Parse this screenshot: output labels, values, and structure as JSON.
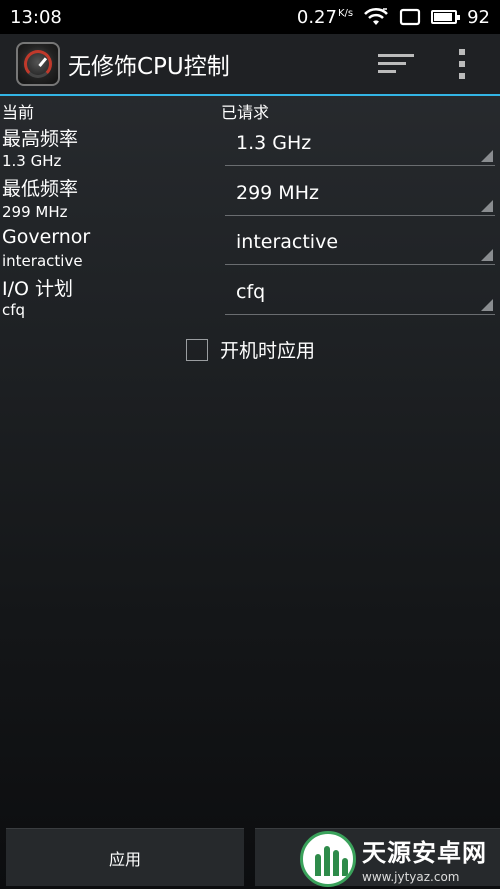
{
  "status_bar": {
    "time": "13:08",
    "net_speed": "0.27",
    "net_unit": "K/s",
    "battery": "92",
    "battery_level": 0.92
  },
  "action_bar": {
    "title": "无修饰CPU控制",
    "sort_icon": "sort-icon",
    "overflow_icon": "overflow-menu-icon"
  },
  "columns": {
    "current": "当前",
    "requested": "已请求"
  },
  "rows": [
    {
      "label": "最高频率",
      "current": "1.3 GHz",
      "requested": "1.3 GHz"
    },
    {
      "label": "最低频率",
      "current": "299 MHz",
      "requested": "299 MHz"
    },
    {
      "label": "Governor",
      "current": "interactive",
      "requested": "interactive"
    },
    {
      "label": "I/O 计划",
      "current": "cfq",
      "requested": "cfq"
    }
  ],
  "apply_on_boot": {
    "label": "开机时应用",
    "checked": false
  },
  "bottom": {
    "apply_label": "应用"
  },
  "watermark": {
    "name": "天源安卓网",
    "url": "www.jytyaz.com"
  },
  "colors": {
    "accent": "#33b5e5",
    "status_bar": "#000000",
    "action_bar": "#1f2124"
  }
}
